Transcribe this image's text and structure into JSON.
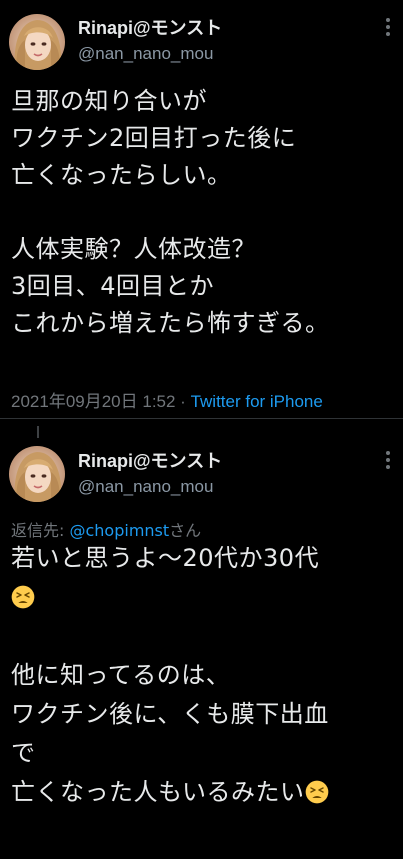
{
  "tweets": [
    {
      "display_name": "Rinapi@モンスト",
      "handle": "@nan_nano_mou",
      "lines": [
        "旦那の知り合いが",
        "ワクチン2回目打った後に",
        "亡くなったらしい。",
        "",
        "人体実験？人体改造？",
        "3回目、4回目とか",
        "これから増えたら怖すぎる。"
      ],
      "timestamp": "2021年09月20日 1:52 · ",
      "source": "Twitter for iPhone"
    },
    {
      "display_name": "Rinapi@モンスト",
      "handle": "@nan_nano_mou",
      "reply_prefix": "返信先: ",
      "reply_mention": "@chopimnst",
      "reply_suffix": "さん",
      "lines": [
        "若いと思うよ〜20代か30代",
        "",
        "",
        "他に知ってるのは、",
        "ワクチン後に、くも膜下出血",
        "で",
        "亡くなった人もいるみたい"
      ],
      "emoji": "tired-face-emoji"
    }
  ],
  "colors": {
    "background": "#000000",
    "text": "#e7e9ea",
    "secondary": "#71767b",
    "link": "#1d9bf0"
  }
}
